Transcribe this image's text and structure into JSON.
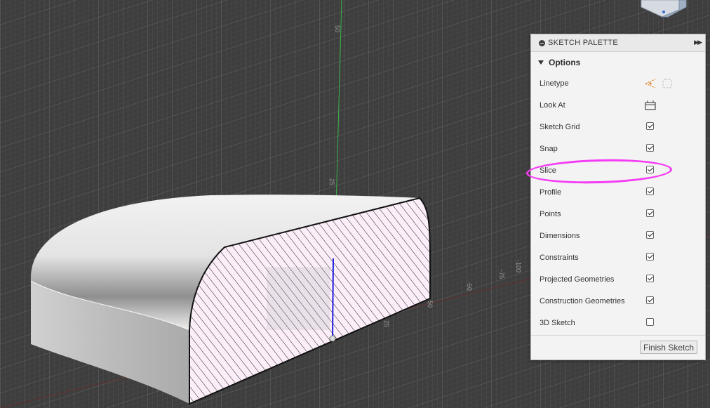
{
  "viewport": {
    "axis_labels": [
      "50",
      "25",
      "25",
      "50",
      "-50",
      "-75",
      "-100",
      "25"
    ]
  },
  "palette": {
    "title": "SKETCH PALETTE",
    "options_label": "Options",
    "rows": [
      {
        "label": "Linetype",
        "type": "icons",
        "icons": [
          "construction-line-icon",
          "centerline-icon"
        ]
      },
      {
        "label": "Look At",
        "type": "icon",
        "icons": [
          "look-at-icon"
        ]
      },
      {
        "label": "Sketch Grid",
        "type": "checkbox",
        "checked": true
      },
      {
        "label": "Snap",
        "type": "checkbox",
        "checked": true
      },
      {
        "label": "Slice",
        "type": "checkbox",
        "checked": true
      },
      {
        "label": "Profile",
        "type": "checkbox",
        "checked": true
      },
      {
        "label": "Points",
        "type": "checkbox",
        "checked": true
      },
      {
        "label": "Dimensions",
        "type": "checkbox",
        "checked": true
      },
      {
        "label": "Constraints",
        "type": "checkbox",
        "checked": true
      },
      {
        "label": "Projected Geometries",
        "type": "checkbox",
        "checked": true
      },
      {
        "label": "Construction Geometries",
        "type": "checkbox",
        "checked": true
      },
      {
        "label": "3D Sketch",
        "type": "checkbox",
        "checked": false
      }
    ],
    "finish_label": "Finish Sketch"
  },
  "colors": {
    "highlight": "#f43cf4",
    "background": "#3f3f3f",
    "grid": "#555555",
    "y_axis": "#3fbf3f",
    "x_axis": "#c03030",
    "z_axis": "#2020e0"
  }
}
